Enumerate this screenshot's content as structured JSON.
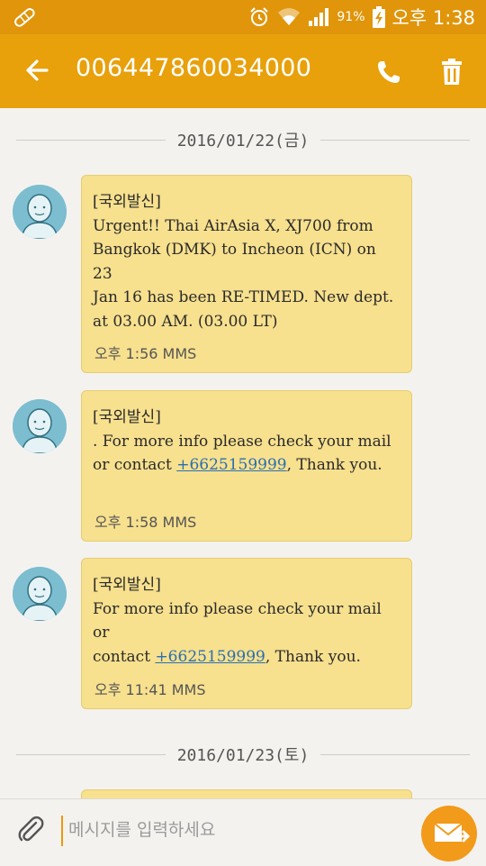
{
  "status_bar": {
    "battery_percent": "91%",
    "time": "오후 1:38"
  },
  "header": {
    "title": "006447860034000"
  },
  "thread": {
    "date_1": "2016/01/22(금)",
    "date_2": "2016/01/23(토)",
    "messages": [
      {
        "sender_tag": "[국외발신]",
        "text": "Urgent!! Thai AirAsia X, XJ700 from\nBangkok (DMK) to Incheon (ICN) on 23\nJan 16 has been RE-TIMED. New dept.\nat 03.00 AM. (03.00 LT)",
        "meta": "오후 1:56 MMS"
      },
      {
        "sender_tag": "[국외발신]",
        "text_before": ". For more info please check your mail\nor contact ",
        "phone": "+6625159999",
        "text_after": ", Thank you.",
        "meta": "오후 1:58 MMS"
      },
      {
        "sender_tag": "[국외발신]",
        "text_before": "For more info please check your mail or\ncontact ",
        "phone": "+6625159999",
        "text_after": ", Thank you.",
        "meta": "오후 11:41 MMS"
      }
    ]
  },
  "composer": {
    "placeholder": "메시지를 입력하세요"
  },
  "colors": {
    "status_bar": "#e0950a",
    "app_bar": "#e8a00b",
    "bubble": "#f7e08e",
    "send_button": "#f29a1a",
    "link": "#2a6fb0"
  }
}
